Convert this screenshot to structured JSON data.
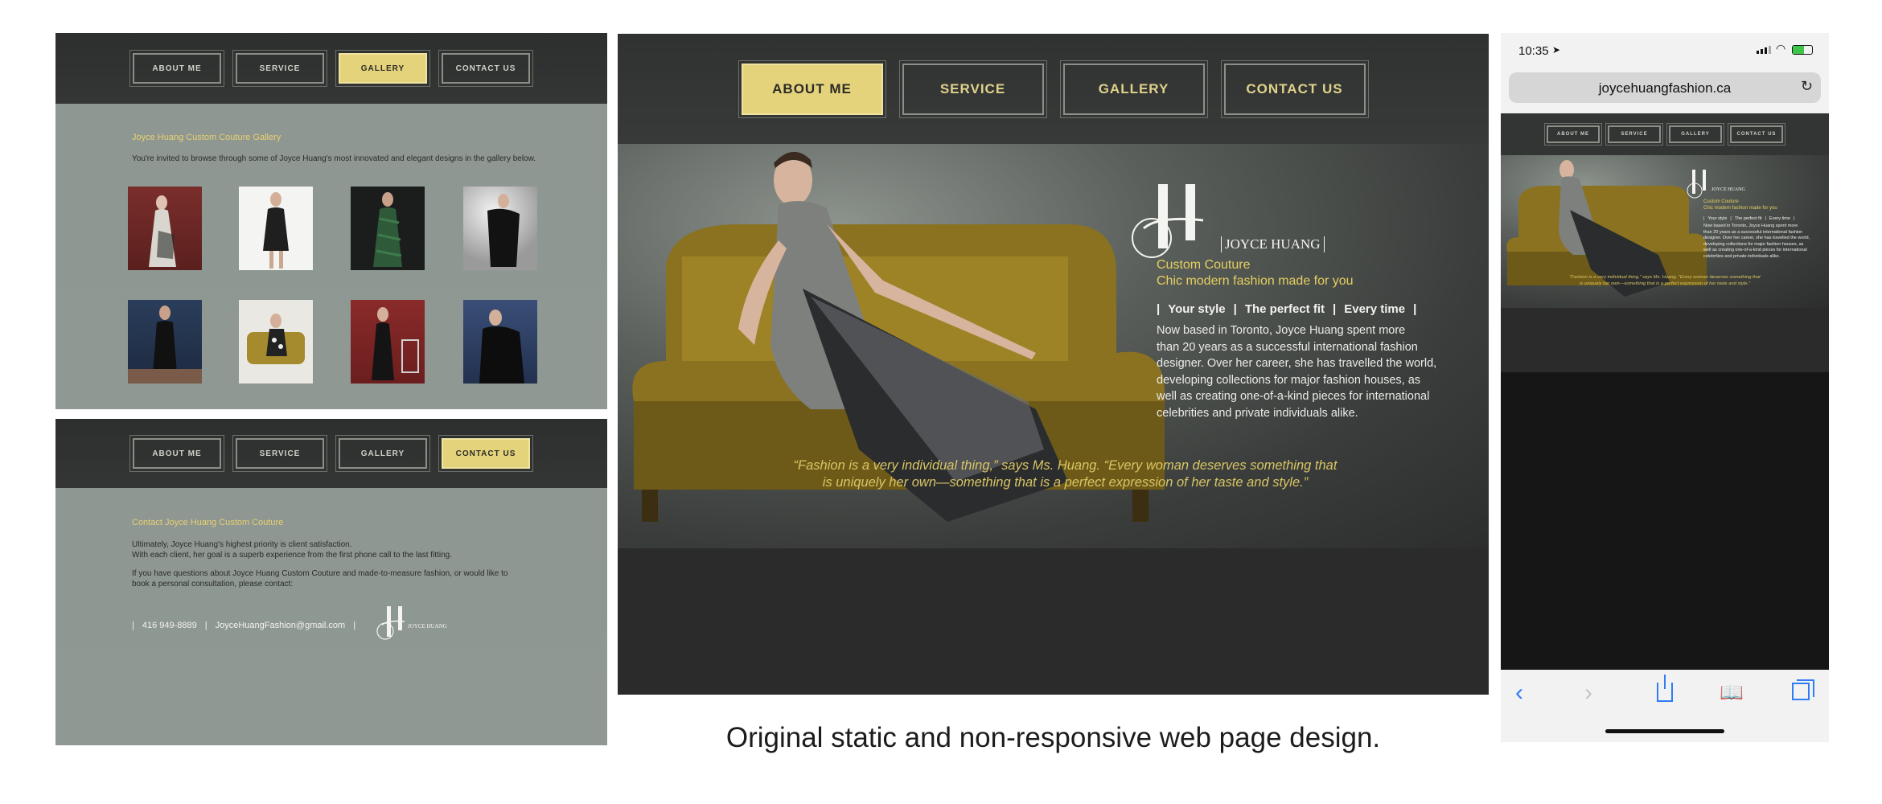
{
  "nav": {
    "about": "ABOUT ME",
    "service": "SERVICE",
    "gallery": "GALLERY",
    "contact": "CONTACT US"
  },
  "gallery_page": {
    "title": "Joyce Huang Custom Couture Gallery",
    "intro": "You're invited to browse through some of Joyce Huang's most innovated and elegant designs in the gallery below."
  },
  "contact_page": {
    "title": "Contact Joyce Huang Custom Couture",
    "p1_line1": "Ultimately, Joyce Huang's highest priority is client satisfaction.",
    "p1_line2": "With each client, her goal is a superb experience from the first phone call to the last fitting.",
    "p2_line1": "If you have questions about Joyce Huang Custom Couture and made-to-measure fashion, or would like to",
    "p2_line2": "book a personal consultation, please contact:",
    "phone": "416  949-8889",
    "email": "JoyceHuangFashion@gmail.com",
    "brand": "JOYCE HUANG"
  },
  "home_page": {
    "brand": "JOYCE HUANG",
    "tagline1": "Custom Couture",
    "tagline2": "Chic modern fashion made for you",
    "features": [
      "Your style",
      "The perfect fit",
      "Every time"
    ],
    "bio": [
      "Now based in Toronto, Joyce Huang spent more",
      "than 20 years as a successful international fashion",
      "designer. Over her career, she has travelled the world,",
      "developing collections for major fashion houses, as",
      "well as creating one-of-a-kind pieces for international",
      "celebrities and private individuals alike."
    ],
    "quote1": "“Fashion is a very individual thing,” says Ms. Huang. “Every woman deserves something that",
    "quote2": "is uniquely her own—something that is a perfect expression of her taste and style.”"
  },
  "caption": "Original static and non-responsive web page design.",
  "phone": {
    "time": "10:35",
    "url": "joycehuangfashion.ca"
  },
  "colors": {
    "accent_gold": "#e5d37c",
    "nav_dark": "#303231",
    "gray_bg": "#8e9791"
  }
}
